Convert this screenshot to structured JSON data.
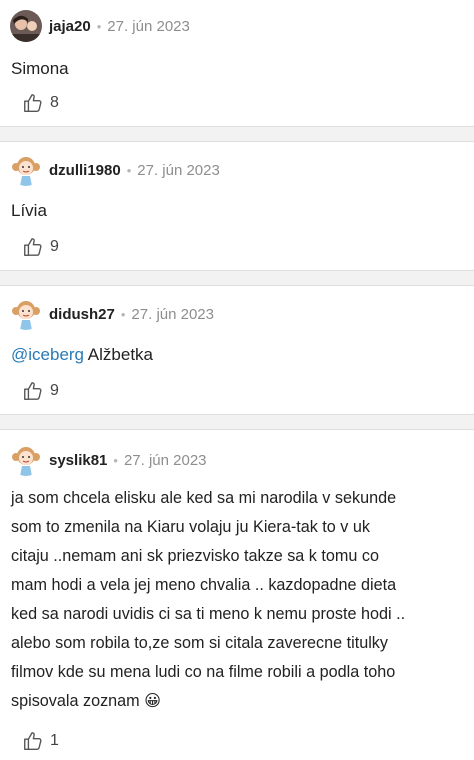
{
  "comments": [
    {
      "username": "jaja20",
      "separator": "•",
      "date": "27. jún 2023",
      "text": "Simona",
      "likes": "8",
      "avatar": "photo"
    },
    {
      "username": "dzulli1980",
      "separator": "•",
      "date": "27. jún 2023",
      "text": "Lívia",
      "likes": "9",
      "avatar": "girl-cartoon"
    },
    {
      "username": "didush27",
      "separator": "•",
      "date": "27. jún 2023",
      "mention": "@iceberg",
      "text": " Alžbetka",
      "likes": "9",
      "avatar": "girl-cartoon"
    },
    {
      "username": "syslik81",
      "separator": "•",
      "date": "27. jún 2023",
      "text_lines": [
        "ja som chcela elisku ale ked sa mi narodila v sekunde",
        "som to zmenila na Kiaru volaju ju Kiera-tak to v uk",
        "citaju ..nemam ani sk priezvisko takze sa k tomu co",
        "mam hodi a vela jej meno chvalia .. kazdopadne dieta",
        "ked sa narodi uvidis ci sa ti meno k nemu proste hodi ..",
        "alebo som robila to,ze som si citala zaverecne titulky",
        "filmov kde su mena ludi co na filme robili a podla toho",
        "spisovala zoznam"
      ],
      "emoji": "😀",
      "likes": "1",
      "avatar": "girl-cartoon"
    }
  ],
  "icons": {
    "like": "thumbs-up-icon",
    "emoji": "grinning-face"
  },
  "colors": {
    "mention": "#2a7ab5",
    "divider": "#f2f2f2",
    "meta": "#8e8e8e"
  }
}
